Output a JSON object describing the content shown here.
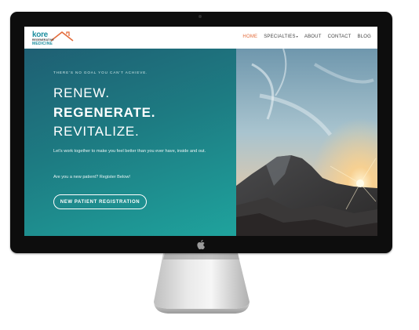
{
  "site": {
    "logo": {
      "line1": "kore",
      "line2": "REGENERATIVE",
      "line3": "MEDICINE"
    },
    "nav": [
      {
        "label": "HOME",
        "active": true
      },
      {
        "label": "SPECIALTIES",
        "dropdown": true
      },
      {
        "label": "ABOUT"
      },
      {
        "label": "CONTACT"
      },
      {
        "label": "BLOG"
      }
    ],
    "nav_dropdown_symbol": "▾",
    "hero": {
      "tagline": "THERE'S NO GOAL YOU CAN'T ACHIEVE.",
      "heading_1": "RENEW.",
      "heading_2": "REGENERATE.",
      "heading_3": "REVITALIZE.",
      "body_1": "Let's work together to make you feel better than you ever have, inside and out.",
      "body_2": "Are you a new patient? Register Below!",
      "cta_label": "NEW PATIENT REGISTRATION"
    }
  },
  "colors": {
    "accent_active_nav": "#e36b3a",
    "brand_teal": "#1e8fa0",
    "hero_gradient_start": "#1f5f73",
    "hero_gradient_end": "#1fa39d"
  },
  "icons": [
    "apple-logo-icon",
    "camera-icon",
    "mountain-photo"
  ]
}
